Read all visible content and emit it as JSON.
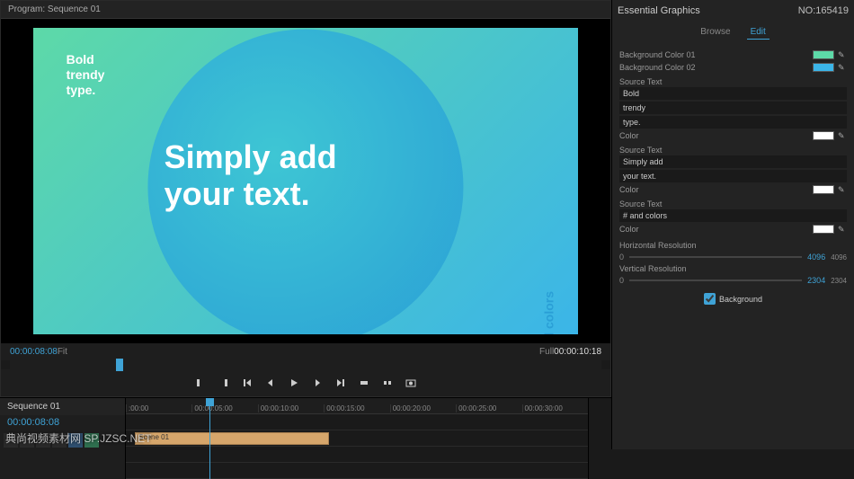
{
  "program": {
    "title": "Program: Sequence 01",
    "tc_left": "00:00:08:08",
    "tc_fit": "Fit",
    "tc_quality": "Full",
    "tc_right": "00:00:10:18"
  },
  "canvas": {
    "bold_text": "Bold\ntrendy\ntype.",
    "main_text": "Simply add\nyour text.",
    "side_text": "# and colors"
  },
  "transport": {
    "mark_in": "Mark In",
    "mark_out": "Mark Out"
  },
  "essential_graphics": {
    "title": "Essential Graphics",
    "tabs": {
      "browse": "Browse",
      "edit": "Edit"
    },
    "bg1_label": "Background Color 01",
    "bg1_color": "#5dd9a8",
    "bg2_label": "Background Color 02",
    "bg2_color": "#3bb5e8",
    "source_text_label": "Source Text",
    "src1": [
      "Bold",
      "trendy",
      "type."
    ],
    "color_label": "Color",
    "color1": "#ffffff",
    "src2": [
      "Simply add",
      "your text."
    ],
    "color2": "#ffffff",
    "src3": [
      "# and colors"
    ],
    "color3": "#ffffff",
    "hres_label": "Horizontal Resolution",
    "hres_val": "4096",
    "hres_max": "4096",
    "vres_label": "Vertical Resolution",
    "vres_val": "2304",
    "vres_max": "2304",
    "background_chk": "Background"
  },
  "timeline": {
    "tab": "Sequence 01",
    "tc": "00:00:08:08",
    "ruler": [
      ":00:00",
      "00:00:05:00",
      "00:00:10:00",
      "00:00:15:00",
      "00:00:20:00",
      "00:00:25:00",
      "00:00:30:00"
    ],
    "clip_name": "Scene 01"
  },
  "watermark": "典尚视频素材网 SP.JZSC.NET",
  "serial": "NO:165419"
}
